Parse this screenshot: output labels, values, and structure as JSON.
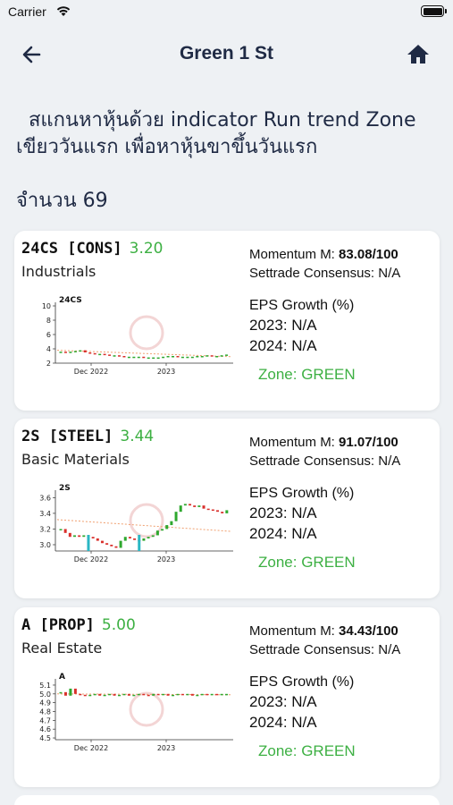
{
  "status": {
    "carrier": "Carrier"
  },
  "nav": {
    "title": "Green 1 St"
  },
  "description": "สแกนหาหุ้นด้วย indicator Run trend  Zone เขียววันแรก เพื่อหาหุ้นขาขึ้นวันแรก",
  "count_label": "จำนวน 69",
  "colors": {
    "accent_green": "#3db043",
    "title_navy": "#1f2a44",
    "candle_up": "#2ea82e",
    "candle_down": "#d9302c",
    "volume": "#2ab7c4",
    "trend_line": "#f0a070"
  },
  "stocks": [
    {
      "symbol": "24CS",
      "category": "[CONS]",
      "price": "3.20",
      "sector": "Industrials",
      "momentum_label": "Momentum M:",
      "momentum_value": "83.08/100",
      "consensus": "Settrade Consensus: N/A",
      "eps_label": "EPS Growth (%)",
      "eps_2023": "2023: N/A",
      "eps_2024": "2024: N/A",
      "zone": "Zone: GREEN",
      "chart": {
        "label": "24CS",
        "y_ticks": [
          "10",
          "8",
          "6",
          "4",
          "2"
        ],
        "x_ticks": [
          "Dec 2022",
          "2023"
        ],
        "ylim": [
          2,
          10
        ],
        "closes": [
          3.6,
          3.5,
          3.6,
          3.7,
          3.8,
          3.5,
          3.4,
          3.3,
          3.3,
          3.2,
          3.1,
          3.1,
          3.0,
          2.9,
          2.9,
          2.9,
          2.9,
          2.8,
          2.8,
          2.8,
          2.8,
          2.9,
          3.0,
          3.0,
          2.9,
          2.9,
          2.9,
          2.9,
          3.0,
          3.0,
          3.1,
          3.0,
          3.0,
          3.1,
          3.2
        ],
        "trend": [
          3.8,
          2.9
        ],
        "volume_spikes": []
      }
    },
    {
      "symbol": "2S",
      "category": "[STEEL]",
      "price": "3.44",
      "sector": "Basic Materials",
      "momentum_label": "Momentum M:",
      "momentum_value": "91.07/100",
      "consensus": "Settrade Consensus: N/A",
      "eps_label": "EPS Growth (%)",
      "eps_2023": "2023: N/A",
      "eps_2024": "2024: N/A",
      "zone": "Zone: GREEN",
      "chart": {
        "label": "2S",
        "y_ticks": [
          "3.6",
          "3.4",
          "3.2",
          "3.0"
        ],
        "x_ticks": [
          "Dec 2022",
          "2023"
        ],
        "ylim": [
          2.92,
          3.65
        ],
        "closes": [
          3.2,
          3.15,
          3.1,
          3.12,
          3.1,
          3.12,
          3.1,
          3.08,
          3.05,
          3.02,
          3.0,
          2.98,
          2.96,
          3.05,
          3.1,
          3.08,
          3.06,
          3.05,
          3.08,
          3.1,
          3.12,
          3.18,
          3.2,
          3.25,
          3.3,
          3.42,
          3.5,
          3.52,
          3.5,
          3.48,
          3.5,
          3.46,
          3.45,
          3.44,
          3.42,
          3.4,
          3.44
        ],
        "trend": [
          3.32,
          3.17
        ],
        "volume_spikes": [
          6,
          17
        ]
      }
    },
    {
      "symbol": "A",
      "category": "[PROP]",
      "price": "5.00",
      "sector": "Real Estate",
      "momentum_label": "Momentum M:",
      "momentum_value": "34.43/100",
      "consensus": "Settrade Consensus: N/A",
      "eps_label": "EPS Growth (%)",
      "eps_2023": "2023: N/A",
      "eps_2024": "2024: N/A",
      "zone": "Zone: GREEN",
      "chart": {
        "label": "A",
        "y_ticks": [
          "5.1",
          "5.0",
          "4.9",
          "4.8",
          "4.7",
          "4.6",
          "4.5"
        ],
        "x_ticks": [
          "Dec 2022",
          "2023"
        ],
        "ylim": [
          4.48,
          5.13
        ],
        "closes": [
          5.02,
          4.98,
          5.06,
          5.0,
          4.99,
          4.98,
          4.99,
          5.0,
          4.98,
          4.99,
          5.0,
          4.98,
          4.99,
          5.0,
          4.98,
          4.99,
          5.0,
          4.99,
          4.98,
          5.0,
          4.99,
          5.0,
          4.98,
          4.99,
          5.0,
          4.99,
          5.0,
          4.98,
          4.99,
          5.0,
          4.99,
          5.0,
          4.99,
          5.0,
          5.0
        ],
        "trend": [
          5.0,
          4.99
        ],
        "volume_spikes": []
      }
    }
  ]
}
